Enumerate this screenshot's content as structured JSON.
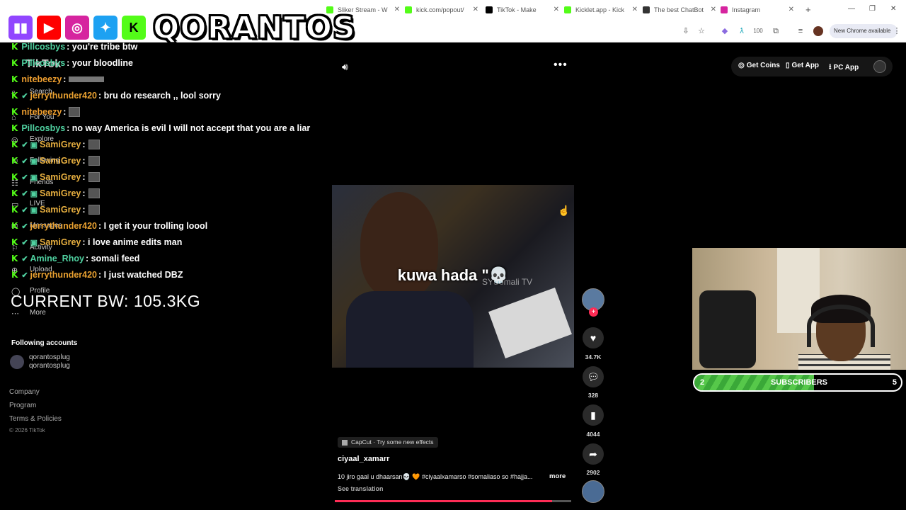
{
  "browser": {
    "tabs": [
      {
        "label": "Sliker Stream - W",
        "color": "#53fc18"
      },
      {
        "label": "kick.com/popout/",
        "color": "#53fc18"
      },
      {
        "label": "TikTok - Make",
        "color": "#000000",
        "active": true
      },
      {
        "label": "Kicklet.app - Kick",
        "color": "#53fc18"
      },
      {
        "label": "The best ChatBot",
        "color": "#333333"
      },
      {
        "label": "Instagram",
        "color": "#d6249f"
      }
    ],
    "new_tab": "+",
    "window_controls": [
      "—",
      "❐",
      "✕"
    ],
    "chrome_update_label": "New Chrome available",
    "extension_badge": "100"
  },
  "overlay": {
    "logos": [
      "twitch",
      "youtube",
      "instagram",
      "twitter",
      "kick"
    ],
    "kick_letter": "K",
    "brand": "QORANTOS",
    "current_bw": "CURRENT BW: 105.3KG"
  },
  "chat": [
    {
      "user": "Pillcosbys",
      "color": "#4fd1a0",
      "msg": ": you're tribe btw",
      "badges": ""
    },
    {
      "user": "Pillcosbys",
      "color": "#4fd1a0",
      "msg": ": your bloodline",
      "badges": ""
    },
    {
      "user": "nitebeezy",
      "color": "#f0a030",
      "msg": " :",
      "badges": "",
      "emote": "wide"
    },
    {
      "user": "jerrythunder420",
      "color": "#e8a030",
      "msg": ": bru do research ,, lool sorry",
      "badges": "✔"
    },
    {
      "user": "nitebeezy",
      "color": "#f0a030",
      "msg": " :",
      "badges": "",
      "emote": "small"
    },
    {
      "user": "Pillcosbys",
      "color": "#4fd1a0",
      "msg": ": no way America is evil I will not accept that you are a liar",
      "badges": ""
    },
    {
      "user": "SamiGrey",
      "color": "#e8b040",
      "msg": " :",
      "badges": "✔ ▣",
      "emote": "small"
    },
    {
      "user": "SamiGrey",
      "color": "#e8b040",
      "msg": " :",
      "badges": "✔ ▣",
      "emote": "small"
    },
    {
      "user": "SamiGrey",
      "color": "#e8b040",
      "msg": " :",
      "badges": "✔ ▣",
      "emote": "small"
    },
    {
      "user": "SamiGrey",
      "color": "#e8b040",
      "msg": " :",
      "badges": "✔ ▣",
      "emote": "small"
    },
    {
      "user": "SamiGrey",
      "color": "#e8b040",
      "msg": " :",
      "badges": "✔ ▣",
      "emote": "small"
    },
    {
      "user": "jerrythunder420",
      "color": "#e8a030",
      "msg": ": I get it your trolling loool",
      "badges": "✔"
    },
    {
      "user": "SamiGrey",
      "color": "#e8b040",
      "msg": " : i love anime edits man",
      "badges": "✔ ▣"
    },
    {
      "user": "Amine_Rhoy",
      "color": "#4fd1a0",
      "msg": " : somali feed",
      "badges": "✔"
    },
    {
      "user": "jerrythunder420",
      "color": "#e8a030",
      "msg": ": I just watched DBZ",
      "badges": "✔"
    }
  ],
  "tiktok": {
    "logo": "TikTok",
    "sidebar": [
      {
        "label": "Search",
        "icon": "search-icon"
      },
      {
        "label": "For You",
        "icon": "home-icon"
      },
      {
        "label": "Explore",
        "icon": "compass-icon"
      },
      {
        "label": "Following",
        "icon": "following-icon"
      },
      {
        "label": "Friends",
        "icon": "friends-icon"
      },
      {
        "label": "LIVE",
        "icon": "live-icon"
      },
      {
        "label": "Messages",
        "icon": "message-icon"
      },
      {
        "label": "Activity",
        "icon": "activity-icon"
      },
      {
        "label": "Upload",
        "icon": "upload-icon"
      },
      {
        "label": "Profile",
        "icon": "profile-icon"
      },
      {
        "label": "More",
        "icon": "more-icon"
      }
    ],
    "following_title": "Following accounts",
    "following": [
      {
        "name": "qorantosplug",
        "handle": "qorantosplug"
      }
    ],
    "footer": [
      "Company",
      "Program",
      "Terms & Policies"
    ],
    "copyright": "© 2026 TikTok",
    "header": {
      "get_coins": "Get Coins",
      "get_app": "Get App",
      "pc_app": "PC App"
    },
    "video": {
      "caption": "kuwa hada \"💀",
      "watermark": "SYSomali TV",
      "progress": 0.92
    },
    "actions": {
      "likes": "34.7K",
      "comments": "328",
      "saves": "4044",
      "shares": "2902"
    },
    "info": {
      "capcut": "CapCut · Try some new effects",
      "author": "ciyaal_xamarr",
      "description": "10 jiro gaal u dhaarsan💀 🧡 #ciyaalxamarso #somaliaso so #hajja...",
      "more": "more",
      "see_translation": "See translation"
    }
  },
  "sub_goal": {
    "start": "2",
    "label": "SUBSCRIBERS",
    "end": "5",
    "progress": 0.58
  }
}
